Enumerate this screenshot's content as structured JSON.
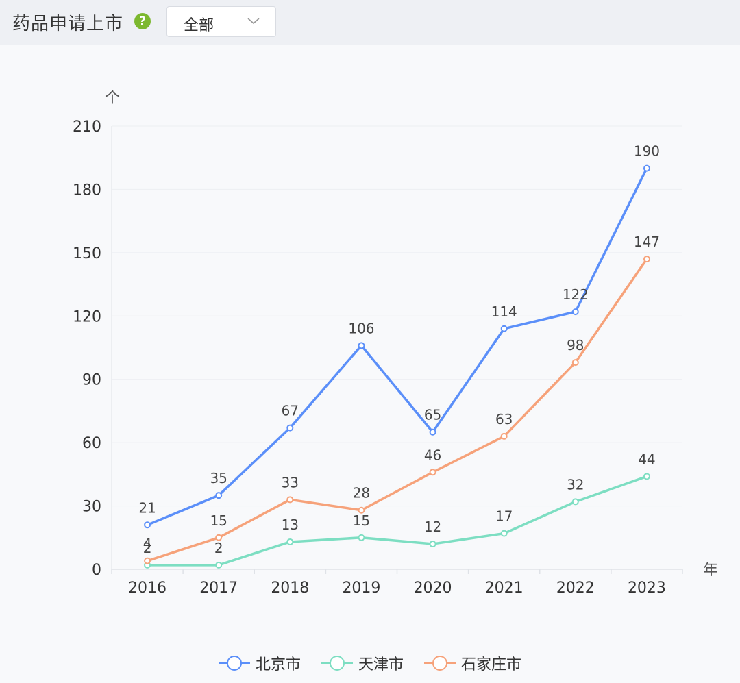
{
  "header": {
    "title": "药品申请上市",
    "help_icon": "help-icon",
    "filter": {
      "selected": "全部"
    }
  },
  "chart_data": {
    "type": "line",
    "title": "",
    "ylabel": "个",
    "xlabel": "年",
    "x": [
      "2016",
      "2017",
      "2018",
      "2019",
      "2020",
      "2021",
      "2022",
      "2023"
    ],
    "ylim": [
      0,
      210
    ],
    "yticks": [
      0,
      30,
      60,
      90,
      120,
      150,
      180,
      210
    ],
    "grid": true,
    "legend_position": "bottom-center",
    "series": [
      {
        "name": "北京市",
        "color": "#5b8ff9",
        "values": [
          21,
          35,
          67,
          106,
          65,
          114,
          122,
          190
        ]
      },
      {
        "name": "天津市",
        "color": "#7ddec2",
        "values": [
          2,
          2,
          13,
          15,
          12,
          17,
          32,
          44
        ]
      },
      {
        "name": "石家庄市",
        "color": "#f6a27a",
        "values": [
          4,
          15,
          33,
          28,
          46,
          63,
          98,
          147
        ]
      }
    ]
  }
}
